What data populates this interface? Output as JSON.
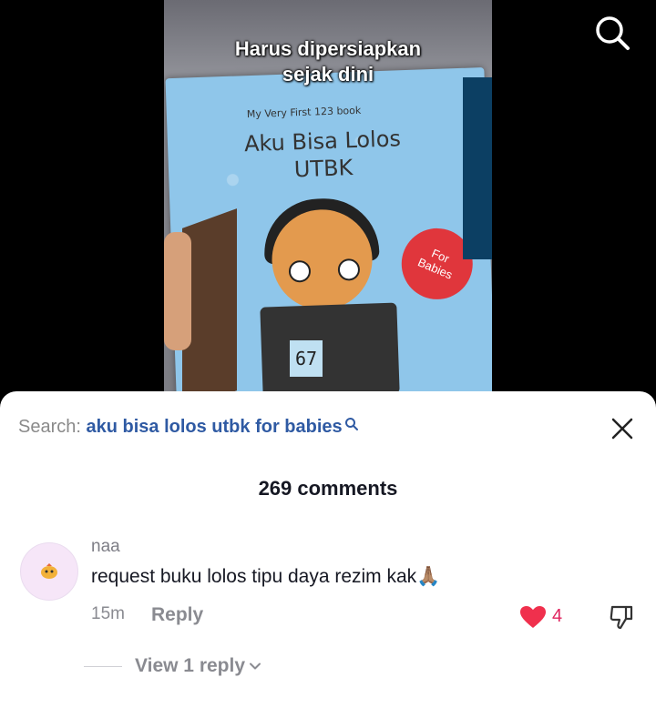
{
  "video": {
    "caption_line1": "Harus dipersiapkan",
    "caption_line2": "sejak dini",
    "book_small_text": "My Very First 123 book",
    "book_title_line1": "Aku Bisa Lolos",
    "book_title_line2": "UTBK",
    "badge_line1": "For",
    "badge_line2": "Babies",
    "sticker_number": "67"
  },
  "comments_sheet": {
    "search_label": "Search: ",
    "search_query": "aku bisa lolos utbk for babies",
    "count_text": "269 comments",
    "comment": {
      "username": "naa",
      "text": "request buku lolos tipu daya rezim kak🙏🏽",
      "time": "15m",
      "reply_label": "Reply",
      "likes": "4",
      "view_replies_label": "View 1 reply"
    }
  },
  "icons": {
    "top_search": "search-icon",
    "close": "close-icon",
    "heart": "heart-icon",
    "dislike": "thumbs-down-icon",
    "chevron": "chevron-down-icon"
  },
  "colors": {
    "query_blue": "#2f5aa3",
    "like_red": "#e0245e"
  }
}
